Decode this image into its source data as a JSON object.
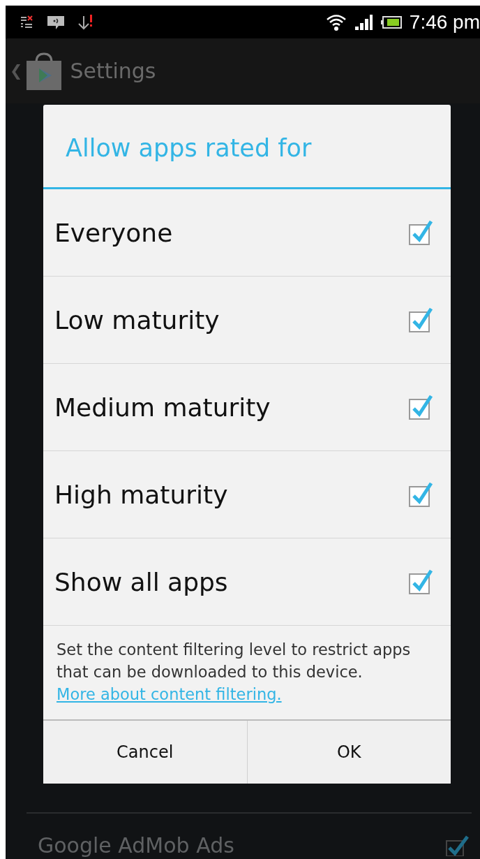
{
  "status_bar": {
    "time": "7:46 pm"
  },
  "action_bar": {
    "back": "❮",
    "title": "Settings"
  },
  "background_list": [
    {
      "label": "Google AdMob Ads",
      "checked": true
    }
  ],
  "dialog": {
    "title": "Allow apps rated for",
    "options": [
      {
        "label": "Everyone",
        "checked": true
      },
      {
        "label": "Low maturity",
        "checked": true
      },
      {
        "label": "Medium maturity",
        "checked": true
      },
      {
        "label": "High maturity",
        "checked": true
      },
      {
        "label": "Show all apps",
        "checked": true
      }
    ],
    "note": "Set the content filtering level to restrict apps that can be downloaded to this device.",
    "link": "More about content filtering.",
    "buttons": [
      "Cancel",
      "OK"
    ]
  }
}
